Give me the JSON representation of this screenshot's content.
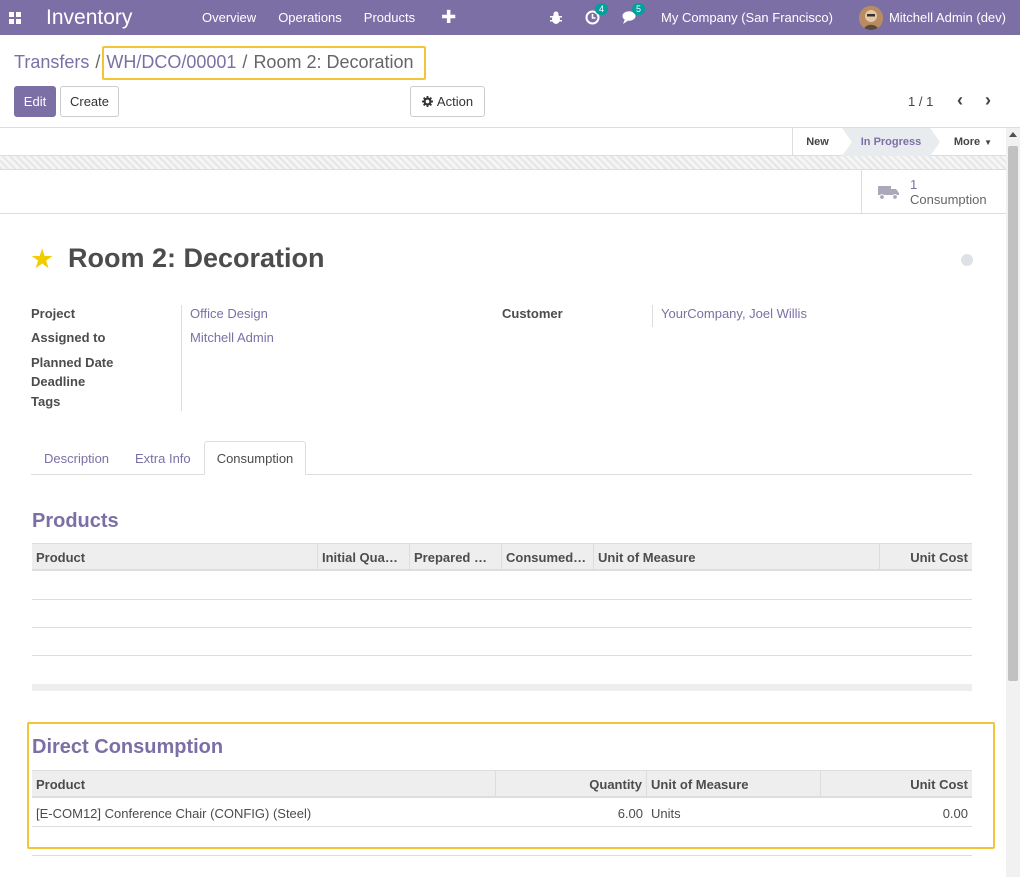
{
  "navbar": {
    "app_name": "Inventory",
    "menu": [
      "Overview",
      "Operations",
      "Products"
    ],
    "company": "My Company (San Francisco)",
    "user": "Mitchell Admin (dev)",
    "activity_count": "4",
    "message_count": "5"
  },
  "breadcrumb": {
    "root": "Transfers",
    "parent": "WH/DCO/00001",
    "current": "Room 2: Decoration"
  },
  "buttons": {
    "edit": "Edit",
    "create": "Create",
    "action": "Action"
  },
  "pager": {
    "value": "1 / 1"
  },
  "statusbar": {
    "stages": [
      "New",
      "In Progress"
    ],
    "active_stage": "In Progress",
    "more": "More"
  },
  "smart_button": {
    "count": "1",
    "label": "Consumption"
  },
  "record": {
    "title": "Room 2: Decoration",
    "starred": true,
    "fields": {
      "project_label": "Project",
      "project": "Office Design",
      "assigned_label": "Assigned to",
      "assigned": "Mitchell Admin",
      "planned_label": "Planned Date",
      "deadline_label": "Deadline",
      "tags_label": "Tags",
      "customer_label": "Customer",
      "customer": "YourCompany, Joel Willis"
    }
  },
  "tabs": [
    "Description",
    "Extra Info",
    "Consumption"
  ],
  "active_tab": "Consumption",
  "products": {
    "title": "Products",
    "columns": [
      "Product",
      "Initial Quantity",
      "Prepared Quantity",
      "Consumed Quantity",
      "Unit of Measure",
      "Unit Cost"
    ],
    "columns_display": [
      "Product",
      "Initial Quan…",
      "Prepared Q…",
      "Consumed …",
      "Unit of Measure",
      "Unit Cost"
    ]
  },
  "direct_consumption": {
    "title": "Direct Consumption",
    "columns": [
      "Product",
      "Quantity",
      "Unit of Measure",
      "Unit Cost"
    ],
    "rows": [
      {
        "product": "[E-COM12] Conference Chair (CONFIG) (Steel)",
        "quantity": "6.00",
        "uom": "Units",
        "unit_cost": "0.00"
      }
    ]
  },
  "colors": {
    "primary": "#7c6fa6",
    "highlight": "#f3c338",
    "badge": "#00a09d",
    "star": "#f3cc00"
  }
}
